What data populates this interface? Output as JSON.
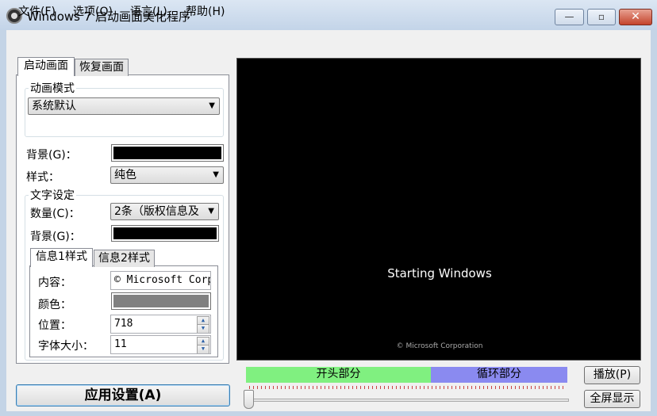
{
  "window": {
    "title": "Windows 7 启动画面美化程序",
    "minimize": "—",
    "maximize": "▫",
    "close": "✕"
  },
  "menu": {
    "file": "文件(F)",
    "options": "选项(O)",
    "language": "语言(L)",
    "help": "帮助(H)"
  },
  "tabs": {
    "boot": "启动画面",
    "resume": "恢复画面"
  },
  "animation": {
    "group_label": "动画模式",
    "mode_value": "系统默认"
  },
  "background": {
    "label": "背景(G)：",
    "color": "#000000"
  },
  "style": {
    "label": "样式：",
    "value": "纯色"
  },
  "text_settings": {
    "group_label": "文字设定",
    "count_label": "数量(C)：",
    "count_value": "2条（版权信息及",
    "bg_label": "背景(G)：",
    "bg_color": "#000000",
    "subtabs": {
      "info1": "信息1样式",
      "info2": "信息2样式"
    },
    "content_label": "内容：",
    "content_value": "© Microsoft Corp",
    "color_label": "颜色：",
    "color_value": "#808080",
    "position_label": "位置：",
    "position_value": "718",
    "font_size_label": "字体大小：",
    "font_size_value": "11"
  },
  "preview": {
    "main_text": "Starting Windows",
    "copyright_text": "© Microsoft Corporation",
    "background": "#000000"
  },
  "timeline": {
    "start_segment": "开头部分",
    "loop_segment": "循环部分",
    "start_color": "#80f080",
    "loop_color": "#8a8af0",
    "slider_position": 0
  },
  "buttons": {
    "apply": "应用设置(A)",
    "play": "播放(P)",
    "fullscreen": "全屏显示"
  }
}
